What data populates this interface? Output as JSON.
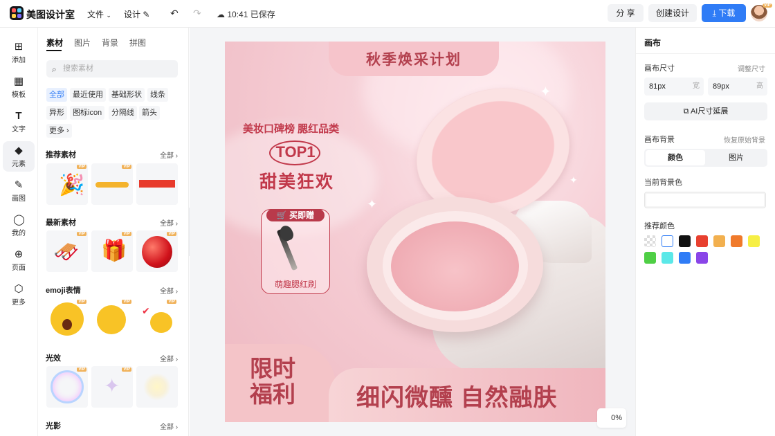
{
  "header": {
    "brand": "美图设计室",
    "menu_file": "文件",
    "menu_design": "设计",
    "saved_status": "10:41 已保存",
    "share_label": "分 享",
    "create_label": "创建设计",
    "download_label": "下载",
    "vip_badge": "VIP"
  },
  "rail": [
    "添加",
    "模板",
    "文字",
    "元素",
    "画图",
    "我的",
    "页面",
    "更多"
  ],
  "panel": {
    "tabs": [
      "素材",
      "图片",
      "背景",
      "拼图"
    ],
    "search_placeholder": "搜索素材",
    "chips": [
      "全部",
      "最近使用",
      "基础形状",
      "线条",
      "异形",
      "图标icon",
      "分隔线",
      "箭头",
      "更多"
    ],
    "sections": [
      "推荐素材",
      "最新素材",
      "emoji表情",
      "光效",
      "光影"
    ],
    "all_label": "全部",
    "vip": "VIP"
  },
  "poster": {
    "banner": "秋季焕采计划",
    "subtitle": "美妆口碑榜 腮红品类",
    "badge": "TOP1",
    "headline": "甜美狂欢",
    "gift_label": "买即赠",
    "gift_item": "萌趣腮红刷",
    "promo_line1": "限时",
    "promo_line2": "福利",
    "slogan": "细闪微醺 自然融肤"
  },
  "zoom": "0%",
  "right": {
    "title": "画布",
    "size_label": "画布尺寸",
    "size_link": "调整尺寸",
    "width_value": "81px",
    "width_unit": "宽",
    "height_value": "89px",
    "height_unit": "高",
    "ai_button": "AI尺寸延展",
    "bg_label": "画布背景",
    "bg_link": "恢复原始背景",
    "seg_color": "颜色",
    "seg_image": "图片",
    "current_bg": "当前背景色",
    "recommend": "推荐颜色",
    "swatches": [
      "transparent",
      "#ffffff",
      "#111111",
      "#e8402f",
      "#f2b04f",
      "#f07a2b",
      "#f6ef45",
      "#4fcf45",
      "#5be8e8",
      "#2f7cf6",
      "#8a45e8"
    ]
  }
}
